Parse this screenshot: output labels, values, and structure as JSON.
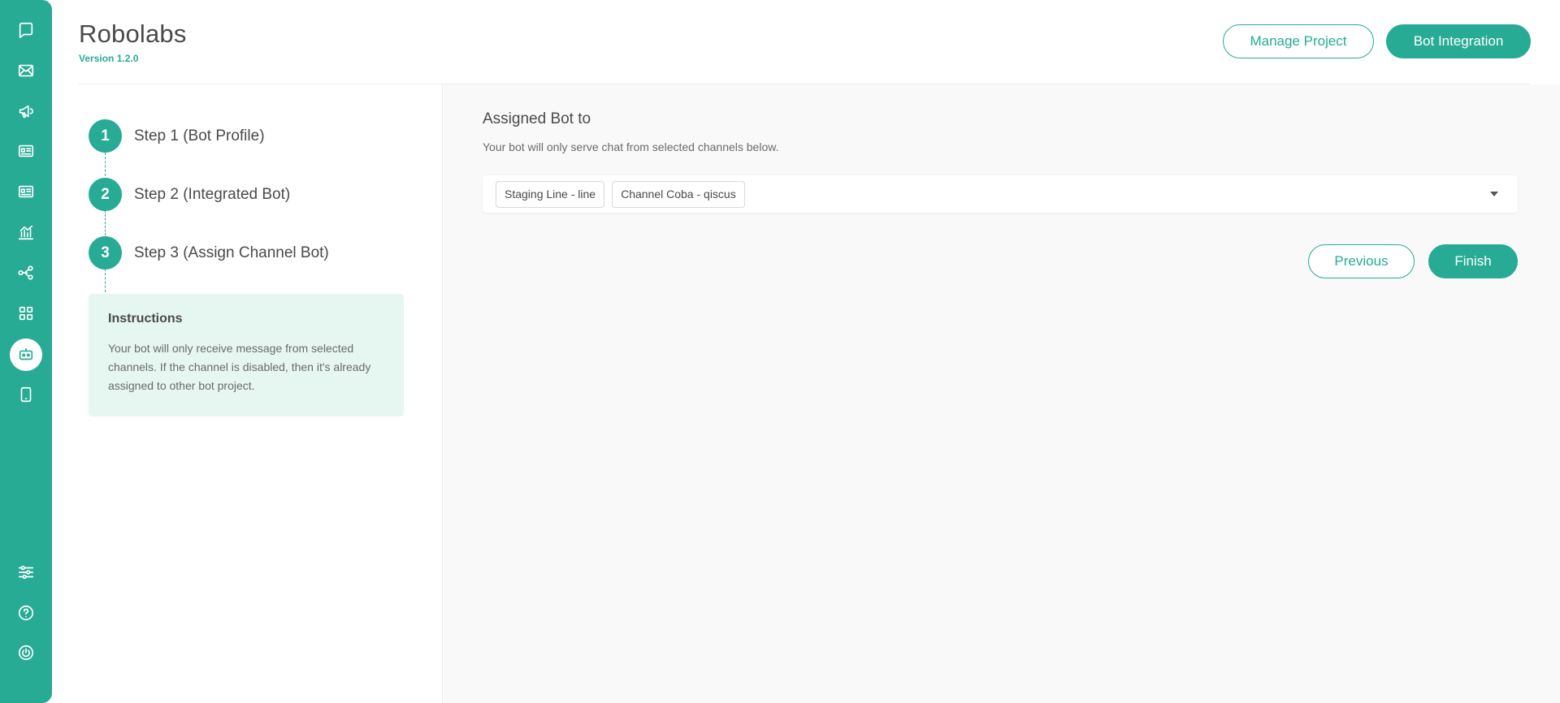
{
  "header": {
    "title": "Robolabs",
    "version": "Version 1.2.0",
    "manage_project_label": "Manage Project",
    "bot_integration_label": "Bot Integration"
  },
  "sidebar": {
    "top_icons": [
      "chat-icon",
      "mail-icon",
      "megaphone-icon",
      "contact-card-icon",
      "contact-card-icon",
      "analytics-icon",
      "integration-share-icon",
      "apps-grid-icon",
      "bot-icon",
      "mobile-icon"
    ],
    "bottom_icons": [
      "settings-sliders-icon",
      "help-icon",
      "power-icon"
    ],
    "active": "bot-icon"
  },
  "steps": [
    {
      "number": "1",
      "label": "Step 1 (Bot Profile)"
    },
    {
      "number": "2",
      "label": "Step 2 (Integrated Bot)"
    },
    {
      "number": "3",
      "label": "Step 3 (Assign Channel Bot)"
    }
  ],
  "instructions": {
    "title": "Instructions",
    "text": "Your bot will only receive message from selected channels. If the channel is disabled, then it's already assigned to other bot project."
  },
  "assign": {
    "title": "Assigned Bot to",
    "subtitle": "Your bot will only serve chat from selected channels below.",
    "selected_channels": [
      "Staging Line - line",
      "Channel Coba - qiscus"
    ]
  },
  "actions": {
    "previous_label": "Previous",
    "finish_label": "Finish"
  },
  "colors": {
    "accent": "#27ab94",
    "instructions_bg": "#e6f6f1",
    "main_bg": "#f9f9f9"
  }
}
